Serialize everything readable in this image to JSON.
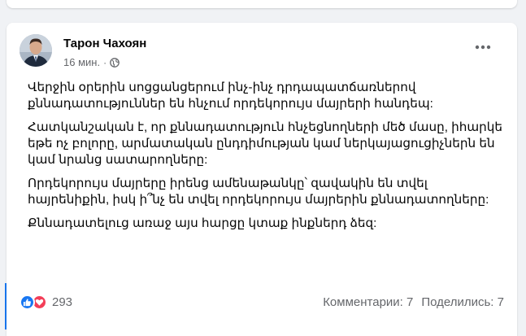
{
  "post": {
    "author": "Тарон Чахоян",
    "time": "16 мин.",
    "separator": "·",
    "privacy_icon": "globe-icon",
    "paragraphs": [
      "Վերջին օրերին սոցցանցերում ինչ-ինչ դրդապատճառներով քննադատություններ են հնչում որդեկորույս մայրերի հանդեպ:",
      "Հատկանշական է, որ քննադատություն հնչեցնողների մեծ մասը, իհարկե եթե ոչ բոլորը, արմատական ընդդիմության կամ ներկայացուցիչներն են կամ նրանց սատարողները:",
      "Որդեկորույս մայրերը իրենց ամենաթանկը՝ զավակին են տվել հայրենիքին, իսկ ի՞նչ են տվել  որդեկորույս մայրերին քննադատողները:",
      "Քննադատելուց առաջ  այս  հարցը կտաք ինքներդ ձեզ:"
    ],
    "reactions_count": "293",
    "comments": "Комментарии: 7",
    "shares": "Поделились: 7"
  },
  "colors": {
    "accent": "#1877f2",
    "love": "#f33e58",
    "secondary_text": "#65676b",
    "background": "#f0f2f5"
  }
}
